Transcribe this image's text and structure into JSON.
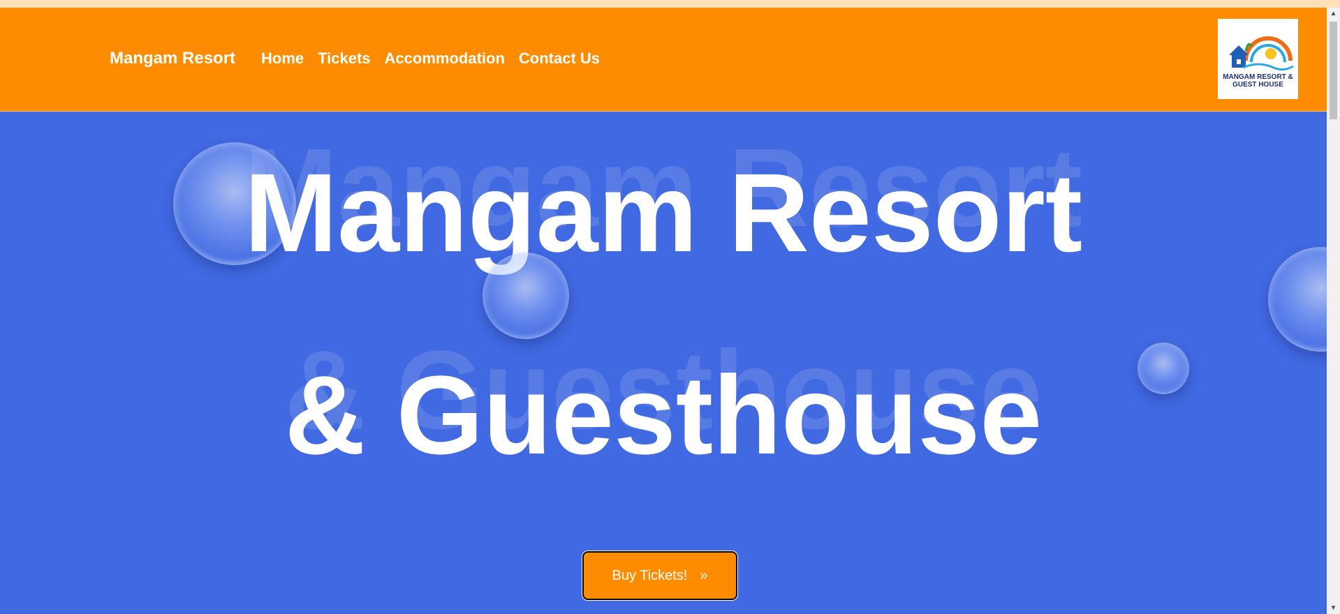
{
  "navbar": {
    "brand": "Mangam Resort",
    "links": [
      "Home",
      "Tickets",
      "Accommodation",
      "Contact Us"
    ],
    "logo_text": "MANGAM RESORT & GUEST HOUSE"
  },
  "hero": {
    "title_line1": "Mangam Resort",
    "title_line2": "& Guesthouse",
    "cta_label": "Buy Tickets!",
    "cta_icon": "»"
  },
  "scrollbar": {
    "up_arrow": "▲",
    "down_arrow": "▼"
  },
  "colors": {
    "navbar": "#ff8c00",
    "hero_background": "#4169e1",
    "cta_background": "#ff8c00",
    "text": "#ffffff"
  }
}
